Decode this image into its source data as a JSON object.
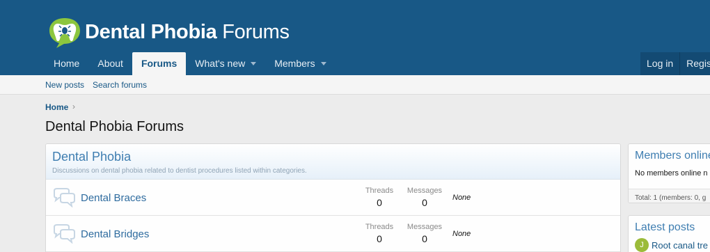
{
  "header": {
    "logo": {
      "bold": "Dental Phobia",
      "regular": "Forums"
    },
    "nav": [
      {
        "label": "Home",
        "has_caret": false,
        "active": false
      },
      {
        "label": "About",
        "has_caret": false,
        "active": false
      },
      {
        "label": "Forums",
        "has_caret": false,
        "active": true
      },
      {
        "label": "What's new",
        "has_caret": true,
        "active": false
      },
      {
        "label": "Members",
        "has_caret": true,
        "active": false
      }
    ],
    "account": {
      "login": "Log in",
      "register": "Regist"
    }
  },
  "subnav": {
    "new_posts": "New posts",
    "search_forums": "Search forums"
  },
  "breadcrumb": {
    "home": "Home",
    "separator": "›"
  },
  "page_title": "Dental Phobia Forums",
  "category": {
    "title": "Dental Phobia",
    "description": "Discussions on dental phobia related to dentist procedures listed within categories.",
    "nodes": [
      {
        "title": "Dental Braces",
        "threads_label": "Threads",
        "threads": "0",
        "messages_label": "Messages",
        "messages": "0",
        "last_post": "None"
      },
      {
        "title": "Dental Bridges",
        "threads_label": "Threads",
        "threads": "0",
        "messages_label": "Messages",
        "messages": "0",
        "last_post": "None"
      }
    ]
  },
  "sidebar": {
    "members_online": {
      "title": "Members online",
      "body": "No members online n",
      "footer": "Total: 1 (members: 0, g"
    },
    "latest_posts": {
      "title": "Latest posts",
      "avatar_letter": "J",
      "first_post": "Root canal tre"
    }
  },
  "colors": {
    "header_bg": "#185886",
    "link": "#185886",
    "accent_green": "#8cc63e",
    "page_bg": "#ececec"
  }
}
